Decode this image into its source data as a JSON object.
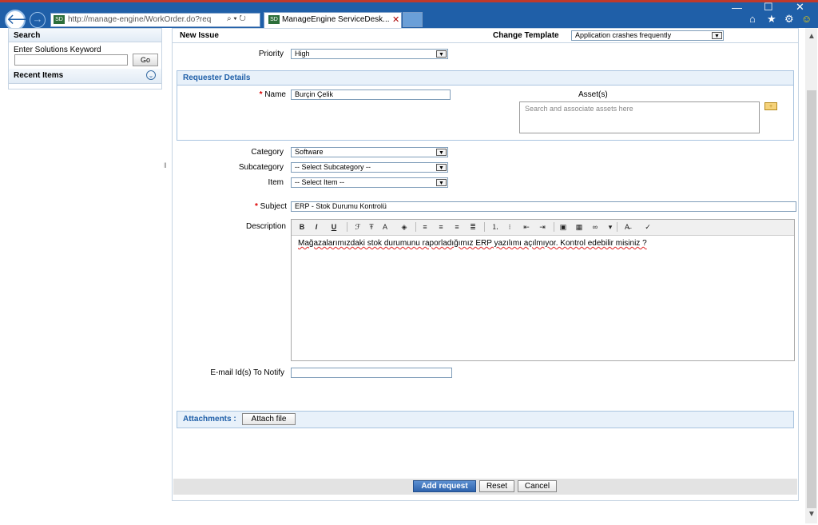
{
  "browser": {
    "address_url": "http://manage-engine/WorkOrder.do?req",
    "address_icons": "⌕ ▾ ↻",
    "favicon_text": "SD",
    "tab_title": "ManageEngine ServiceDesk...",
    "tab_close": "✕",
    "back_glyph": "🡐",
    "fwd_glyph": "→",
    "min_glyph": "—",
    "max_glyph": "☐",
    "close_glyph": "✕",
    "home_glyph": "⌂",
    "star_glyph": "★",
    "gear_glyph": "⚙",
    "smiley_glyph": "☺"
  },
  "sidebar": {
    "search_title": "Search",
    "keyword_label": "Enter Solutions Keyword",
    "keyword_value": "",
    "go_label": "Go",
    "recent_title": "Recent Items",
    "recent_chevron": "⌄",
    "splitter_glyph": "‖"
  },
  "form": {
    "title": "New Issue",
    "change_template_label": "Change Template",
    "template_value": "Application crashes frequently",
    "priority_label": "Priority",
    "priority_value": "High",
    "requester_section_title": "Requester Details",
    "name_label": "Name",
    "name_value": "Burçin Çelik",
    "assets_label": "Asset(s)",
    "assets_placeholder": "Search and associate assets here",
    "category_label": "Category",
    "category_value": "Software",
    "subcategory_label": "Subcategory",
    "subcategory_value": "-- Select Subcategory --",
    "item_label": "Item",
    "item_value": "-- Select Item --",
    "subject_label": "Subject",
    "subject_value": "ERP - Stok Durumu Kontrolü",
    "description_label": "Description",
    "description_text": "Mağazalarımızdaki stok durumunu raporladığımız ERP yazılımı açılmıyor. Kontrol edebilir misiniz ?",
    "email_label": "E-mail Id(s) To Notify",
    "email_value": "",
    "attachments_label": "Attachments :",
    "attach_button": "Attach file",
    "required_marker": "*",
    "dropdown_glyph": "▼"
  },
  "toolbar": {
    "bold": "B",
    "italic": "I",
    "underline": "U"
  },
  "actions": {
    "add_request": "Add request",
    "reset": "Reset",
    "cancel": "Cancel"
  },
  "scrollbar": {
    "up": "▲",
    "down": "▼"
  }
}
